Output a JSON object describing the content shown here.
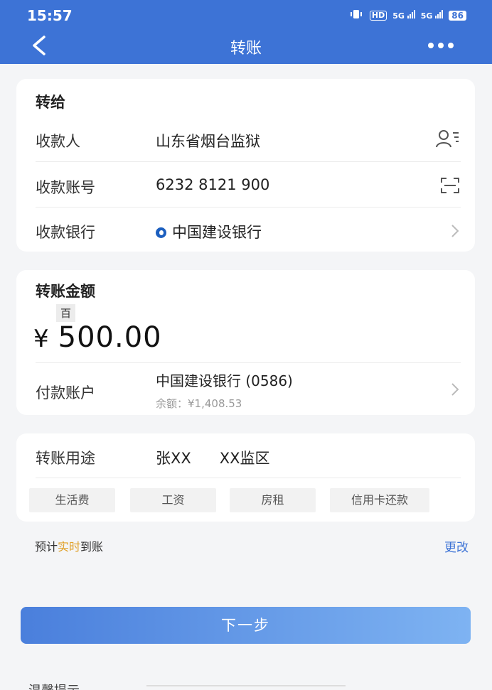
{
  "status_bar": {
    "time": "15:57",
    "hd_label": "HD",
    "net1": "5G",
    "net2": "5G",
    "battery": "86"
  },
  "nav": {
    "back_icon": "chevron-left-icon",
    "title": "转账",
    "more_icon": "more-dots-icon"
  },
  "payee": {
    "section_title": "转给",
    "name_label": "收款人",
    "name_value": "山东省烟台监狱",
    "account_label": "收款账号",
    "account_value": "6232 8121 900",
    "bank_label": "收款银行",
    "bank_value": "中国建设银行"
  },
  "amount": {
    "section_title": "转账金额",
    "unit_tag": "百",
    "currency": "¥",
    "value": "500.00",
    "pay_account_label": "付款账户",
    "pay_account_bank": "中国建设银行 (0586)",
    "balance": "余额：¥1,408.53"
  },
  "purpose": {
    "label": "转账用途",
    "value_part1": "张XX",
    "value_part2": "XX监区",
    "chips": [
      "生活费",
      "工资",
      "房租",
      "信用卡还款"
    ]
  },
  "eta": {
    "prefix": "预计",
    "highlight": "实时",
    "suffix": "到账",
    "change_link": "更改"
  },
  "next_button": "下一步",
  "tips_label": "温馨提示",
  "colors": {
    "brand_blue": "#3d73d6",
    "highlight_orange": "#e0a12a"
  }
}
